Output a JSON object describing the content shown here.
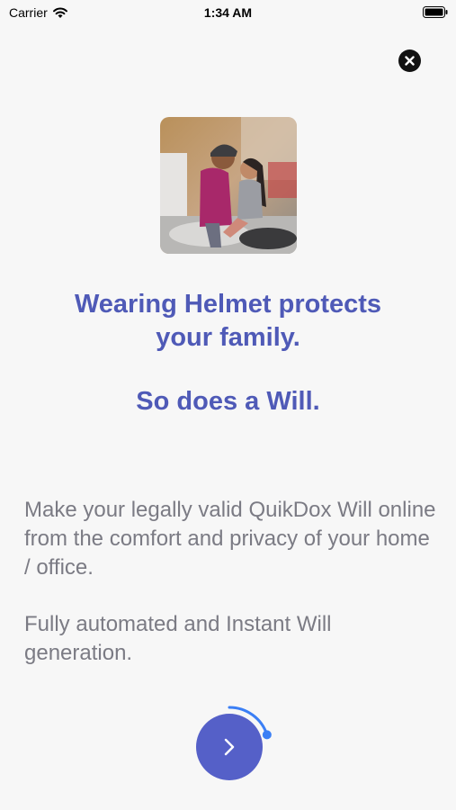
{
  "status_bar": {
    "carrier": "Carrier",
    "time": "1:34 AM"
  },
  "onboarding": {
    "headline": "Wearing Helmet protects your family.",
    "subheadline": "So does a Will.",
    "body_paragraph_1": "Make your legally valid QuikDox Will online from the comfort and privacy of your home / office.",
    "body_paragraph_2": "Fully automated and Instant Will generation.",
    "image_icon": "couple-on-scooter-photo",
    "progress_fraction": 0.2
  },
  "icons": {
    "close": "close-icon",
    "next": "chevron-right-icon"
  },
  "colors": {
    "accent": "#4f5ab7",
    "button": "#5560c8",
    "ring": "#3b7ff5",
    "body_text": "#7b7b84"
  }
}
